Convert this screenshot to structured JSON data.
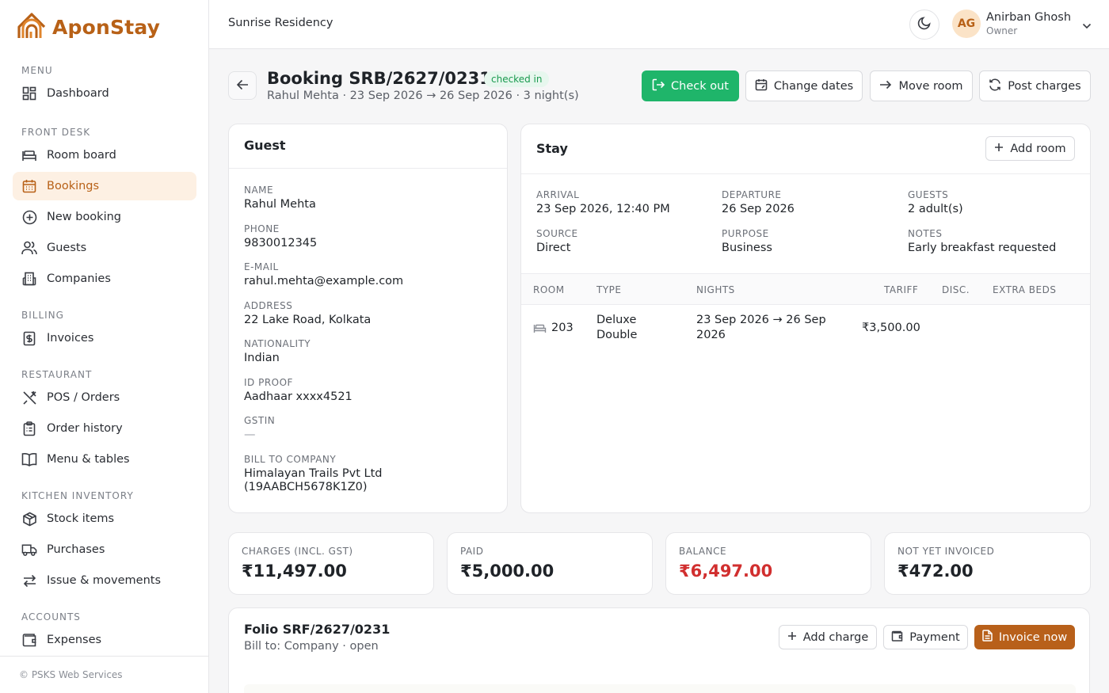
{
  "app": {
    "name": "AponStay",
    "property": "Sunrise Residency",
    "footer": "© PSKS Web Services"
  },
  "colors": {
    "brand": "#b86117",
    "success": "#1fb56a",
    "danger": "#d12f2f"
  },
  "user": {
    "initials": "AG",
    "name": "Anirban Ghosh",
    "role": "Owner"
  },
  "sidebar": {
    "sections": [
      {
        "title": "MENU",
        "items": [
          {
            "label": "Dashboard",
            "icon": "dashboard-icon"
          }
        ]
      },
      {
        "title": "FRONT DESK",
        "items": [
          {
            "label": "Room board",
            "icon": "bed-icon"
          },
          {
            "label": "Bookings",
            "icon": "calendar-icon",
            "active": true
          },
          {
            "label": "New booking",
            "icon": "plus-circle-icon"
          },
          {
            "label": "Guests",
            "icon": "users-icon"
          },
          {
            "label": "Companies",
            "icon": "building-icon"
          }
        ]
      },
      {
        "title": "BILLING",
        "items": [
          {
            "label": "Invoices",
            "icon": "invoice-icon"
          }
        ]
      },
      {
        "title": "RESTAURANT",
        "items": [
          {
            "label": "POS / Orders",
            "icon": "utensils-icon"
          },
          {
            "label": "Order history",
            "icon": "clipboard-icon"
          },
          {
            "label": "Menu & tables",
            "icon": "book-icon"
          }
        ]
      },
      {
        "title": "KITCHEN INVENTORY",
        "items": [
          {
            "label": "Stock items",
            "icon": "package-icon"
          },
          {
            "label": "Purchases",
            "icon": "truck-icon"
          },
          {
            "label": "Issue & movements",
            "icon": "arrows-icon"
          }
        ]
      },
      {
        "title": "ACCOUNTS",
        "items": [
          {
            "label": "Expenses",
            "icon": "wallet-icon"
          }
        ]
      }
    ]
  },
  "booking": {
    "title": "Booking SRB/2627/0231",
    "status": "checked in",
    "subtitle": "Rahul Mehta · 23 Sep 2026 → 26 Sep 2026 · 3 night(s)"
  },
  "actions": {
    "check_out": "Check out",
    "change_dates": "Change dates",
    "move_room": "Move room",
    "post_charges": "Post charges"
  },
  "guest": {
    "title": "Guest",
    "fields": [
      {
        "label": "NAME",
        "value": "Rahul Mehta"
      },
      {
        "label": "PHONE",
        "value": "9830012345"
      },
      {
        "label": "E-MAIL",
        "value": "rahul.mehta@example.com"
      },
      {
        "label": "ADDRESS",
        "value": "22 Lake Road, Kolkata"
      },
      {
        "label": "NATIONALITY",
        "value": "Indian"
      },
      {
        "label": "ID PROOF",
        "value": "Aadhaar xxxx4521"
      },
      {
        "label": "GSTIN",
        "value": "—"
      },
      {
        "label": "BILL TO COMPANY",
        "value": "Himalayan Trails Pvt Ltd",
        "value2": "(19AABCH5678K1Z0)"
      }
    ]
  },
  "stay": {
    "title": "Stay",
    "add_room": "Add room",
    "arrival": {
      "label": "ARRIVAL",
      "value": "23 Sep 2026, 12:40 PM"
    },
    "departure": {
      "label": "DEPARTURE",
      "value": "26 Sep 2026"
    },
    "guests": {
      "label": "GUESTS",
      "value": "2 adult(s)"
    },
    "source": {
      "label": "SOURCE",
      "value": "Direct"
    },
    "purpose": {
      "label": "PURPOSE",
      "value": "Business"
    },
    "notes": {
      "label": "NOTES",
      "value": "Early breakfast requested"
    },
    "columns": {
      "room": "ROOM",
      "type": "TYPE",
      "nights": "NIGHTS",
      "tariff": "TARIFF",
      "disc": "DISC.",
      "extra_beds": "EXTRA BEDS"
    },
    "rooms": [
      {
        "room": "203",
        "type_line1": "Deluxe",
        "type_line2": "Double",
        "nights_line1": "23 Sep 2026 → 26 Sep",
        "nights_line2": "2026",
        "tariff": "₹3,500.00"
      }
    ]
  },
  "summary": [
    {
      "label": "CHARGES (INCL. GST)",
      "value": "₹11,497.00"
    },
    {
      "label": "PAID",
      "value": "₹5,000.00"
    },
    {
      "label": "BALANCE",
      "value": "₹6,497.00"
    },
    {
      "label": "NOT YET INVOICED",
      "value": "₹472.00"
    }
  ],
  "folio": {
    "title": "Folio SRF/2627/0231",
    "subtitle": "Bill to: Company · open",
    "add_charge": "Add charge",
    "payment": "Payment",
    "invoice_now": "Invoice now"
  }
}
